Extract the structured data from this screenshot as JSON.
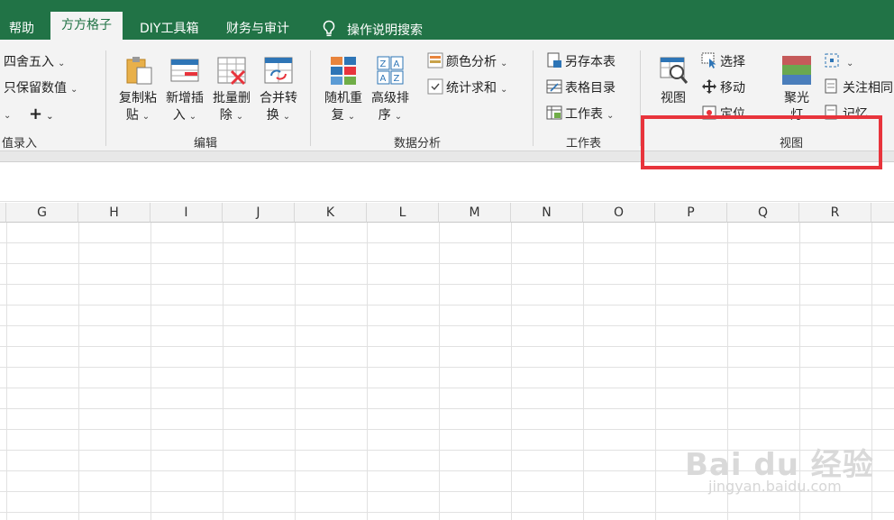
{
  "tabs": {
    "help": "帮助",
    "fangfang": "方方格子",
    "diy": "DIY工具箱",
    "finance": "财务与审计",
    "tell_me": "操作说明搜索"
  },
  "ribbon": {
    "left_partial": {
      "round": "四舍五入",
      "keep_value": "只保留数值",
      "plus": "+",
      "group_label": "值录入"
    },
    "edit": {
      "copy_paste": [
        "复制粘",
        "贴"
      ],
      "insert": [
        "新增插",
        "入"
      ],
      "batch_delete": [
        "批量删",
        "除"
      ],
      "merge_convert": [
        "合并转",
        "换"
      ],
      "group_label": "编辑"
    },
    "analysis": {
      "random_dup": [
        "随机重",
        "复"
      ],
      "advanced_sort": [
        "高级排",
        "序"
      ],
      "color_analysis": "颜色分析",
      "stat_sum": "统计求和",
      "group_label": "数据分析"
    },
    "worksheet": {
      "save_as": "另存本表",
      "table_index": "表格目录",
      "worksheet": "工作表",
      "group_label": "工作表"
    },
    "view": {
      "view_btn": "视图",
      "select": "选择",
      "move": "移动",
      "locate": "定位",
      "spotlight": [
        "聚光",
        "灯"
      ],
      "follow_same": "关注相同",
      "memory": "记忆",
      "group_label": "视图"
    }
  },
  "columns": [
    "G",
    "H",
    "I",
    "J",
    "K",
    "L",
    "M",
    "N",
    "O",
    "P",
    "Q",
    "R"
  ],
  "watermark": {
    "main": "Bai du 经验",
    "sub": "jingyan.baidu.com"
  },
  "colors": {
    "accent": "#217346",
    "highlight": "#e8343c"
  }
}
